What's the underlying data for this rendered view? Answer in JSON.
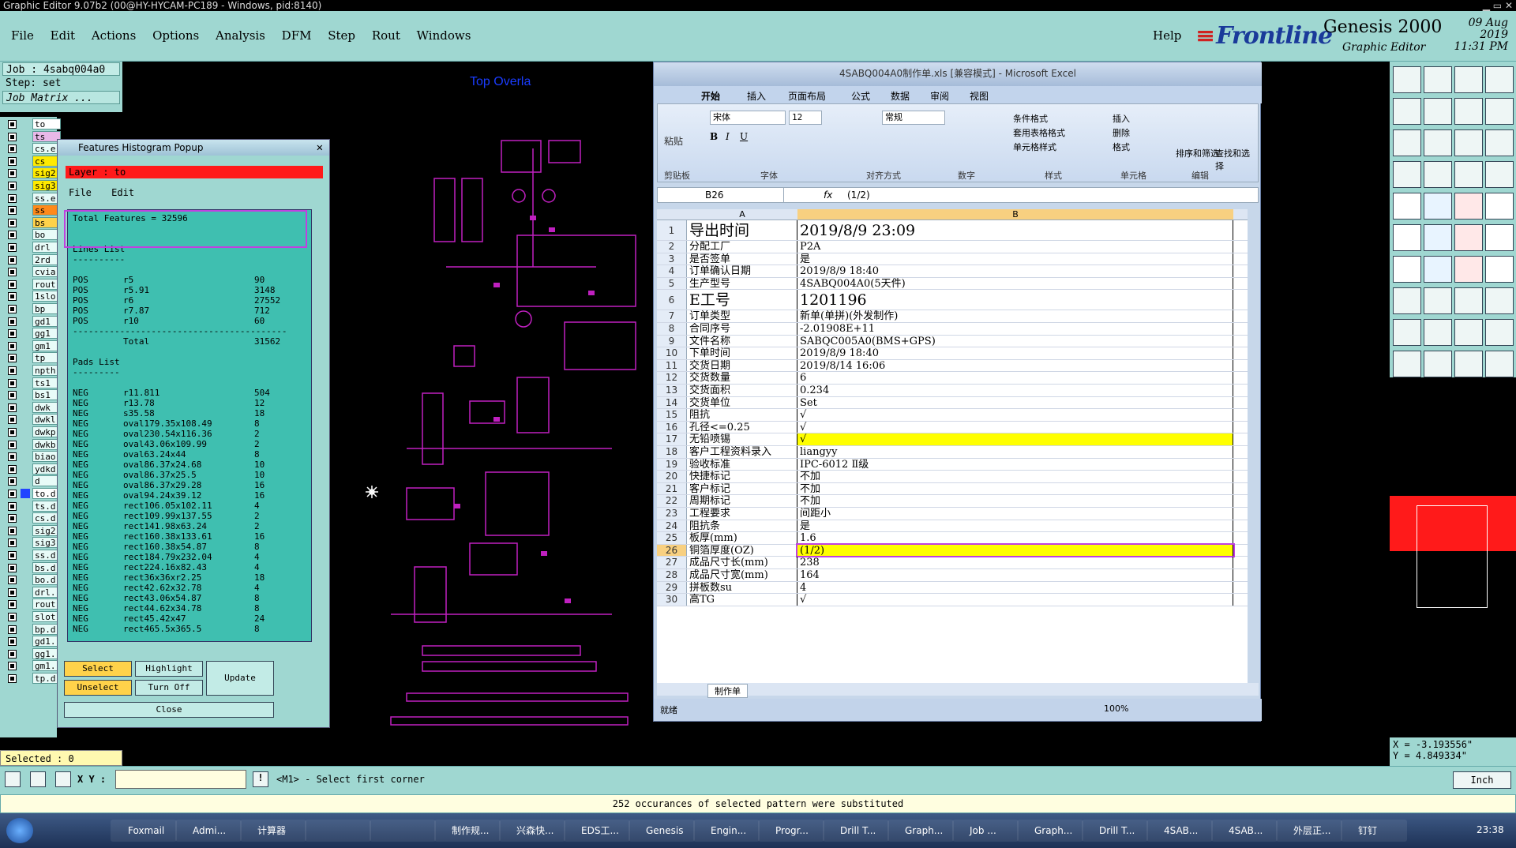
{
  "titlebar": "Graphic Editor 9.07b2 (00@HY-HYCAM-PC189 - Windows, pid:8140)",
  "menu": [
    "File",
    "Edit",
    "Actions",
    "Options",
    "Analysis",
    "DFM",
    "Step",
    "Rout",
    "Windows"
  ],
  "help": "Help",
  "logo": "Frontline",
  "genesis": "Genesis 2000",
  "genesis_sub": "Graphic Editor",
  "date": "09 Aug 2019",
  "time": "11:31 PM",
  "job": "Job : 4sabq004a0",
  "step": "Step: set",
  "job_matrix": "Job Matrix ...",
  "layers": [
    "to",
    "ts",
    "cs.e",
    "cs",
    "sig2",
    "sig3",
    "ss.e",
    "ss",
    "bs",
    "bo",
    "drl",
    "2rd",
    "cvia",
    "rout",
    "1slo",
    "bp",
    "gd1",
    "gg1",
    "gm1",
    "tp",
    "npth",
    "ts1",
    "bs1",
    "dwk",
    "dwkl",
    "dwkp",
    "dwkb",
    "biao",
    "ydkd",
    "d",
    "to.d",
    "ts.d",
    "cs.d",
    "sig2",
    "sig3",
    "ss.d",
    "bs.d",
    "bo.d",
    "drl.",
    "rout",
    "slot",
    "bp.d",
    "gd1.",
    "gg1.",
    "gm1.",
    "tp.d"
  ],
  "selected": "Selected : 0",
  "hist": {
    "title": "Features Histogram Popup",
    "layer": "Layer :  to",
    "menu_file": "File",
    "menu_edit": "Edit",
    "total_features": "Total Features = 32596",
    "lines_heading": "Lines List",
    "lines": [
      [
        "POS",
        "r5",
        "90"
      ],
      [
        "POS",
        "r5.91",
        "3148"
      ],
      [
        "POS",
        "r6",
        "27552"
      ],
      [
        "POS",
        "r7.87",
        "712"
      ],
      [
        "POS",
        "r10",
        "60"
      ]
    ],
    "lines_total_label": "Total",
    "lines_total": "31562",
    "pads_heading": "Pads List",
    "pads": [
      [
        "NEG",
        "r11.811",
        "504"
      ],
      [
        "NEG",
        "r13.78",
        "12"
      ],
      [
        "NEG",
        "s35.58",
        "18"
      ],
      [
        "NEG",
        "oval179.35x108.49",
        "8"
      ],
      [
        "NEG",
        "oval230.54x116.36",
        "2"
      ],
      [
        "NEG",
        "oval43.06x109.99",
        "2"
      ],
      [
        "NEG",
        "oval63.24x44",
        "8"
      ],
      [
        "NEG",
        "oval86.37x24.68",
        "10"
      ],
      [
        "NEG",
        "oval86.37x25.5",
        "10"
      ],
      [
        "NEG",
        "oval86.37x29.28",
        "16"
      ],
      [
        "NEG",
        "oval94.24x39.12",
        "16"
      ],
      [
        "NEG",
        "rect106.05x102.11",
        "4"
      ],
      [
        "NEG",
        "rect109.99x137.55",
        "2"
      ],
      [
        "NEG",
        "rect141.98x63.24",
        "2"
      ],
      [
        "NEG",
        "rect160.38x133.61",
        "16"
      ],
      [
        "NEG",
        "rect160.38x54.87",
        "8"
      ],
      [
        "NEG",
        "rect184.79x232.04",
        "4"
      ],
      [
        "NEG",
        "rect224.16x82.43",
        "4"
      ],
      [
        "NEG",
        "rect36x36xr2.25",
        "18"
      ],
      [
        "NEG",
        "rect42.62x32.78",
        "4"
      ],
      [
        "NEG",
        "rect43.06x54.87",
        "8"
      ],
      [
        "NEG",
        "rect44.62x34.78",
        "8"
      ],
      [
        "NEG",
        "rect45.42x47",
        "24"
      ],
      [
        "NEG",
        "rect465.5x365.5",
        "8"
      ]
    ],
    "btn_select": "Select",
    "btn_highlight": "Highlight",
    "btn_update": "Update",
    "btn_unselect": "Unselect",
    "btn_turnoff": "Turn Off",
    "btn_close": "Close"
  },
  "canvas": {
    "overlay_label": "Top Overla"
  },
  "excel": {
    "title": "4SABQ004A0制作单.xls  [兼容模式] - Microsoft Excel",
    "tabs": [
      "开始",
      "插入",
      "页面布局",
      "公式",
      "数据",
      "审阅",
      "视图"
    ],
    "font": "宋体",
    "size": "12",
    "numfmt": "常规",
    "groups": [
      "剪贴板",
      "字体",
      "对齐方式",
      "数字",
      "样式",
      "单元格",
      "编辑"
    ],
    "style_items": [
      "条件格式",
      "套用表格格式",
      "单元格样式"
    ],
    "cell_items": [
      "插入",
      "删除",
      "格式"
    ],
    "edit_items": [
      "排序和筛选",
      "查找和选择"
    ],
    "paste": "粘贴",
    "namebox": "B26",
    "formula": "(1/2)",
    "col_a": "A",
    "col_b": "B",
    "rows": [
      [
        "1",
        "导出时间",
        "2019/8/9 23:09"
      ],
      [
        "2",
        "分配工厂",
        "P2A"
      ],
      [
        "3",
        "是否签单",
        "是"
      ],
      [
        "4",
        "订单确认日期",
        "2019/8/9 18:40"
      ],
      [
        "5",
        "生产型号",
        "4SABQ004A0(5天件)"
      ],
      [
        "6",
        "E工号",
        "1201196"
      ],
      [
        "7",
        "订单类型",
        "新单(单拼)(外发制作)"
      ],
      [
        "8",
        "合同序号",
        "-2.01908E+11"
      ],
      [
        "9",
        "文件名称",
        "SABQC005A0(BMS+GPS)"
      ],
      [
        "10",
        "下单时间",
        "2019/8/9 18:40"
      ],
      [
        "11",
        "交货日期",
        "2019/8/14 16:06"
      ],
      [
        "12",
        "交货数量",
        "6"
      ],
      [
        "13",
        "交货面积",
        "0.234"
      ],
      [
        "14",
        "交货单位",
        "Set"
      ],
      [
        "15",
        "阻抗",
        "√"
      ],
      [
        "16",
        "孔径<=0.25",
        "√"
      ],
      [
        "17",
        "无铅喷锡",
        "√"
      ],
      [
        "18",
        "客户工程资料录入",
        "liangyy"
      ],
      [
        "19",
        "验收标准",
        "IPC-6012 Ⅱ级"
      ],
      [
        "20",
        "快捷标记",
        "不加"
      ],
      [
        "21",
        "客户标记",
        "不加"
      ],
      [
        "22",
        "周期标记",
        "不加"
      ],
      [
        "23",
        "工程要求",
        "间距小"
      ],
      [
        "24",
        "阻抗条",
        "是"
      ],
      [
        "25",
        "板厚(mm)",
        "1.6"
      ],
      [
        "26",
        "铜箔厚度(OZ)",
        "(1/2)"
      ],
      [
        "27",
        "成品尺寸长(mm)",
        "238"
      ],
      [
        "28",
        "成品尺寸宽(mm)",
        "164"
      ],
      [
        "29",
        "拼板数su",
        "4"
      ],
      [
        "30",
        "高TG",
        "√"
      ]
    ],
    "sheet": "制作单",
    "status": "就绪",
    "zoom": "100%"
  },
  "coords": {
    "x": "X = -3.193556\"",
    "y": "Y = 4.849334\""
  },
  "cmd": {
    "xy_label": "X Y :",
    "prompt": "<M1> - Select first corner",
    "unit": "Inch"
  },
  "message": "252 occurances of selected pattern were substituted",
  "taskbar": {
    "items": [
      "Foxmail",
      "Admi...",
      "计算器",
      "",
      "",
      "制作规...",
      "兴森快...",
      "EDS工...",
      "Genesis",
      "Engin...",
      "Progr...",
      "Drill T...",
      "Graph...",
      "Job ...",
      "Graph...",
      "Drill T...",
      "4SAB...",
      "4SAB...",
      "外层正...",
      "钉钉"
    ],
    "time": "23:38"
  },
  "colors": {
    "teal": "#9fd7d1",
    "red": "#ff1a1a",
    "yellow": "#ffff00",
    "magenta": "#c020c0"
  }
}
